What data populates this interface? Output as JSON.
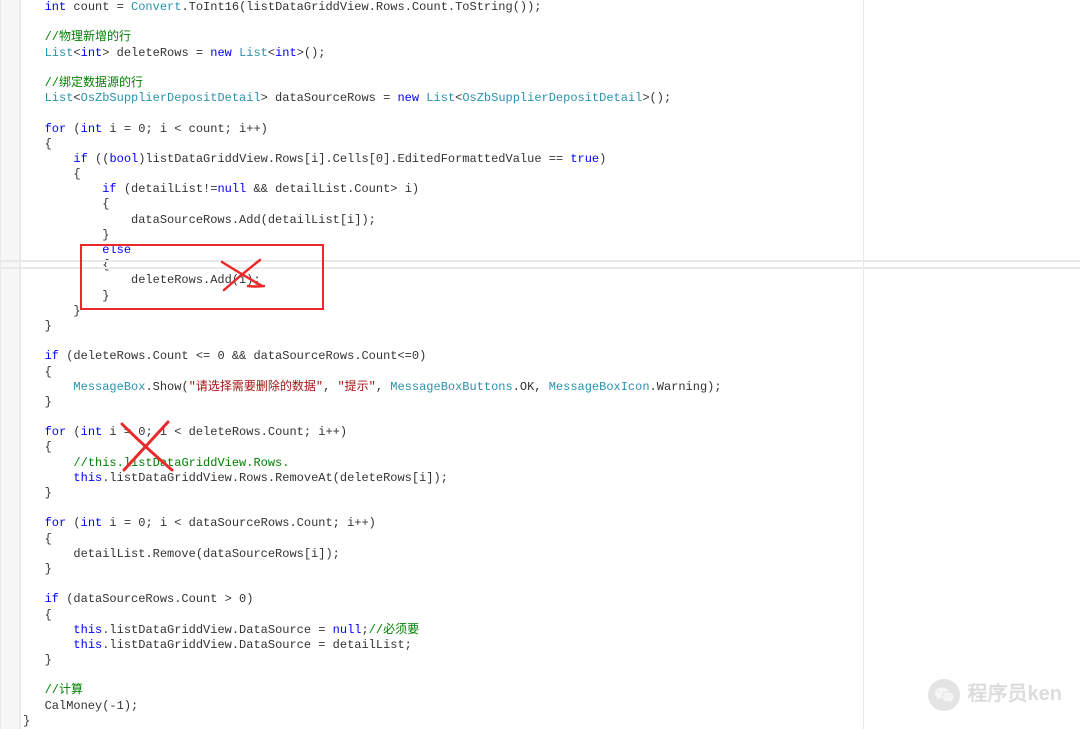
{
  "code": {
    "l1": "            int count = Convert.ToInt16(listDataGriddView.Rows.Count.ToString());",
    "l2": "",
    "l3": "            //物理新增的行",
    "l4": "            List<int> deleteRows = new List<int>();",
    "l5": "",
    "l6": "            //绑定数据源的行",
    "l7": "            List<OsZbSupplierDepositDetail> dataSourceRows = new List<OsZbSupplierDepositDetail>();",
    "l8": "",
    "l9": "            for (int i = 0; i < count; i++)",
    "l10": "            {",
    "l11": "                if ((bool)listDataGriddView.Rows[i].Cells[0].EditedFormattedValue == true)",
    "l12": "                {",
    "l13": "                    if (detailList!=null && detailList.Count> i)",
    "l14": "                    {",
    "l15": "                        dataSourceRows.Add(detailList[i]);",
    "l16": "                    }",
    "l17": "                    else",
    "l18": "                    {",
    "l19": "                        deleteRows.Add(i);",
    "l20": "                    }",
    "l21": "                }",
    "l22": "            }",
    "l23": "",
    "l24": "            if (deleteRows.Count <= 0 && dataSourceRows.Count<=0)",
    "l25": "            {",
    "l26": "                MessageBox.Show(\"请选择需要删除的数据\", \"提示\", MessageBoxButtons.OK, MessageBoxIcon.Warning);",
    "l27": "            }",
    "l28": "",
    "l29": "            for (int i = 0; i < deleteRows.Count; i++)",
    "l30": "            {",
    "l31": "                //this.listDataGriddView.Rows.",
    "l32": "                this.listDataGriddView.Rows.RemoveAt(deleteRows[i]);",
    "l33": "            }",
    "l34": "",
    "l35": "            for (int i = 0; i < dataSourceRows.Count; i++)",
    "l36": "            {",
    "l37": "                detailList.Remove(dataSourceRows[i]);",
    "l38": "            }",
    "l39": "",
    "l40": "            if (dataSourceRows.Count > 0)",
    "l41": "            {",
    "l42": "                this.listDataGriddView.DataSource = null;//必须要",
    "l43": "                this.listDataGriddView.DataSource = detailList;",
    "l44": "            }",
    "l45": "",
    "l46": "            //计算",
    "l47": "            CalMoney(-1);",
    "l48": "        }"
  },
  "watermark": {
    "text": "程序员ken"
  }
}
